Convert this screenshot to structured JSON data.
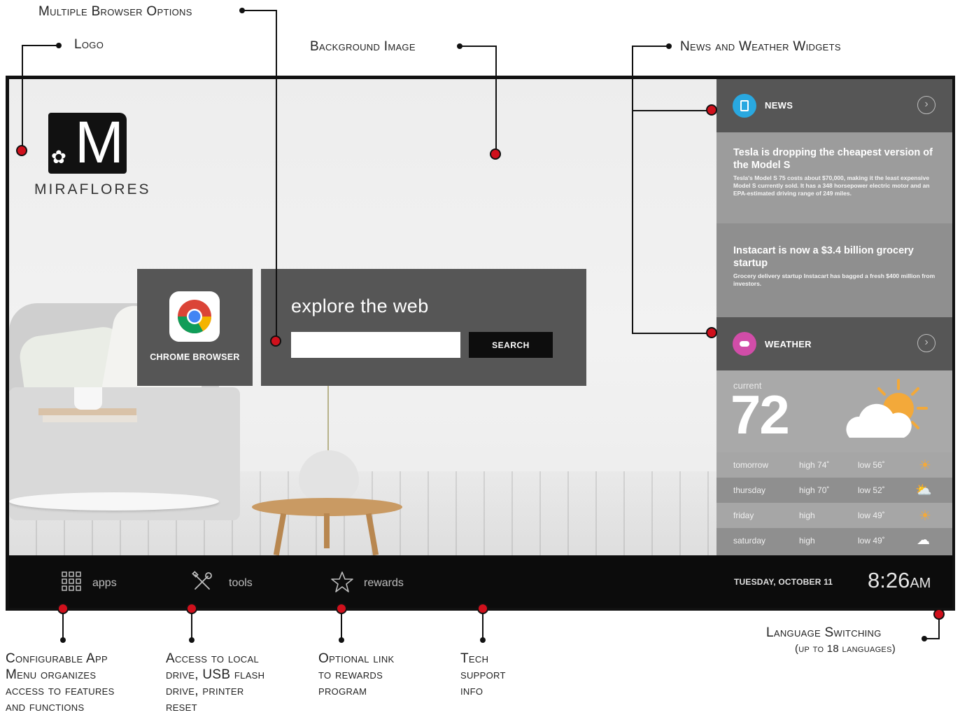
{
  "annotations": {
    "browser_options": "Multiple Browser Options",
    "logo": "Logo",
    "background_image": "Background Image",
    "widgets": "News and Weather Widgets",
    "app_menu": [
      "Configurable App",
      "Menu organizes",
      "access to features",
      "and functions"
    ],
    "tools": [
      "Access to local",
      "drive, USB flash",
      "drive, printer",
      "reset"
    ],
    "rewards": [
      "Optional link",
      "to rewards",
      "program"
    ],
    "support": [
      "Tech",
      "support",
      "info"
    ],
    "language": "Language Switching",
    "language_note": "(up to 18 languages)"
  },
  "logo": {
    "letter": "M",
    "wordmark": "MIRAFLORES"
  },
  "browser": {
    "label": "CHROME BROWSER"
  },
  "search": {
    "title": "explore the web",
    "placeholder": "",
    "button": "SEARCH"
  },
  "news": {
    "title": "NEWS",
    "items": [
      {
        "headline": "Tesla is dropping the cheapest version of the Model S",
        "body": "Tesla's Model S 75 costs about $70,000, making it the least expensive Model S currently sold. It has a 348 horsepower electric motor and an EPA-estimated driving range of 249 miles."
      },
      {
        "headline": "Instacart is now a $3.4 billion grocery startup",
        "body": "Grocery delivery startup Instacart has bagged a fresh $400 million from investors."
      }
    ]
  },
  "weather": {
    "title": "WEATHER",
    "current_label": "current",
    "current_temp": "72",
    "forecast": [
      {
        "day": "tomorrow",
        "high": "high 74˚",
        "low": "low 56˚",
        "icon": "sun-icon"
      },
      {
        "day": "thursday",
        "high": "high 70˚",
        "low": "low 52˚",
        "icon": "partly-cloudy-icon"
      },
      {
        "day": "friday",
        "high": "high",
        "low": "low 49˚",
        "icon": "sun-icon"
      },
      {
        "day": "saturday",
        "high": "high",
        "low": "low 49˚",
        "icon": "rain-cloud-icon"
      }
    ]
  },
  "taskbar": {
    "apps": "apps",
    "tools": "tools",
    "rewards": "rewards",
    "date": "TUESDAY, OCTOBER 11",
    "time": "8:26",
    "ampm": "AM"
  },
  "colors": {
    "annotation_dot": "#d0101c",
    "tile": "#565656",
    "news_bg": "#9c9c9c",
    "taskbar": "#0c0c0c"
  }
}
